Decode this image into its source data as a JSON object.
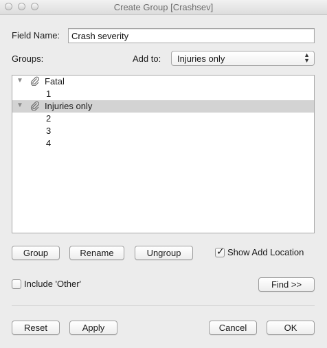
{
  "window": {
    "title": "Create Group [Crashsev]"
  },
  "field_name": {
    "label": "Field Name:",
    "value": "Crash severity"
  },
  "groups_label": "Groups:",
  "add_to": {
    "label": "Add to:",
    "selected": "Injuries only"
  },
  "tree": [
    {
      "type": "group",
      "label": "Fatal",
      "expanded": true,
      "selected": false
    },
    {
      "type": "member",
      "label": "1"
    },
    {
      "type": "group",
      "label": "Injuries only",
      "expanded": true,
      "selected": true
    },
    {
      "type": "member",
      "label": "2"
    },
    {
      "type": "member",
      "label": "3"
    },
    {
      "type": "member",
      "label": "4"
    }
  ],
  "buttons": {
    "group": "Group",
    "rename": "Rename",
    "ungroup": "Ungroup",
    "find": "Find >>",
    "reset": "Reset",
    "apply": "Apply",
    "cancel": "Cancel",
    "ok": "OK"
  },
  "show_add_location": {
    "label": "Show Add Location",
    "checked": true
  },
  "include_other": {
    "label": "Include 'Other'",
    "checked": false
  },
  "icons": {
    "group_icon": "paperclip-icon",
    "expand_icon": "triangle-down-icon"
  }
}
